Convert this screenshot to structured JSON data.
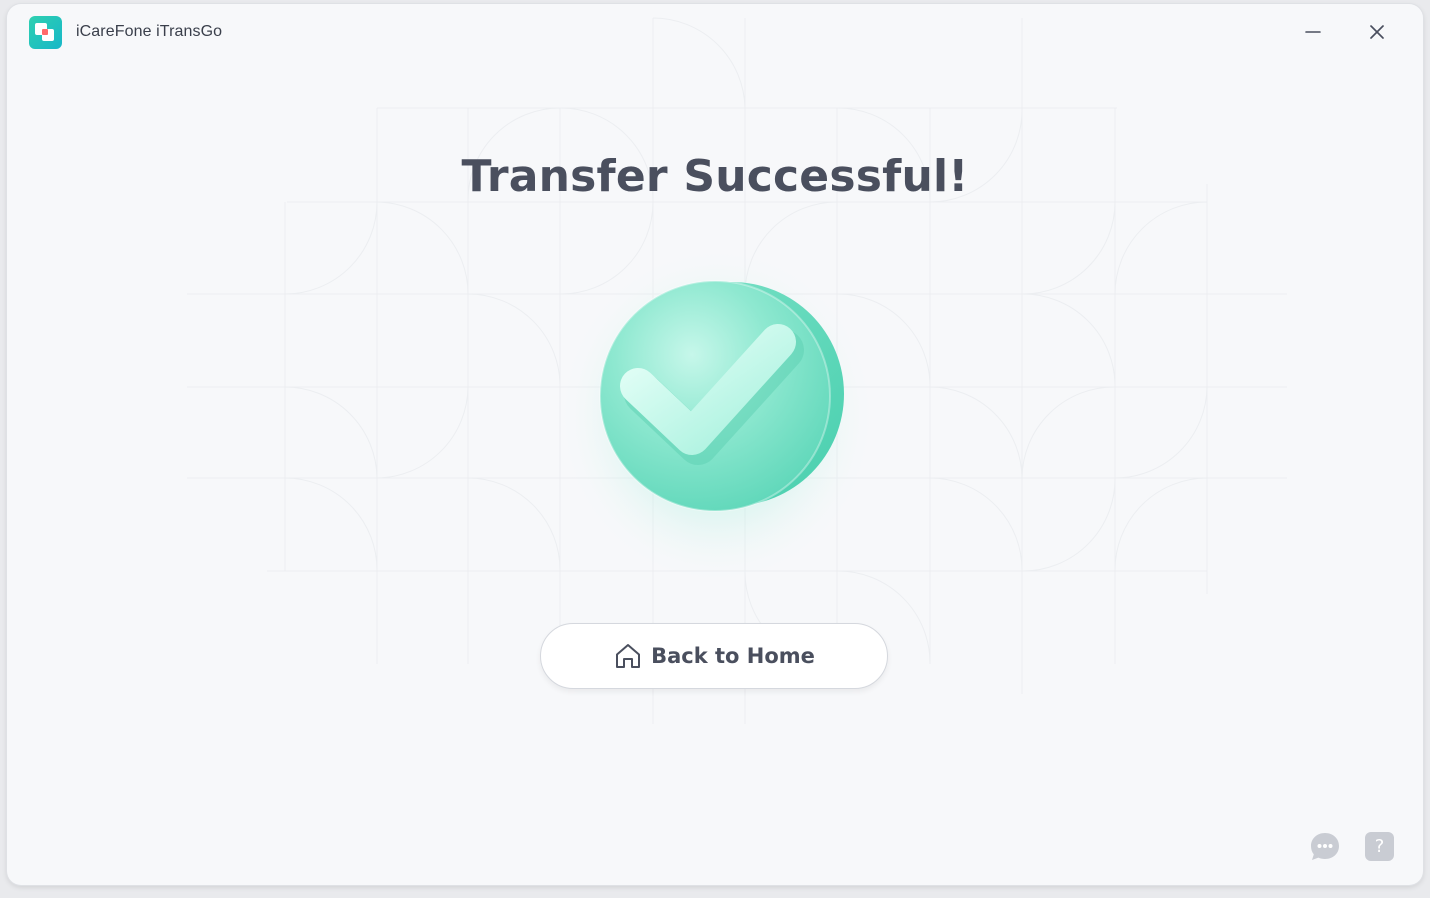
{
  "window": {
    "title": "iCareFone iTransGo"
  },
  "main": {
    "headline": "Transfer Successful!",
    "status_icon": "check-circle-icon",
    "home_button_label": "Back to Home",
    "home_button_icon": "home-icon"
  },
  "footer": {
    "feedback_icon": "chat-bubble-icon",
    "help_icon": "question-mark-icon",
    "help_glyph": "?"
  },
  "colors": {
    "accent": "#3fd4b4",
    "headline": "#4a4f5e",
    "background": "#f7f8fa",
    "button_border": "#d5d8de"
  }
}
